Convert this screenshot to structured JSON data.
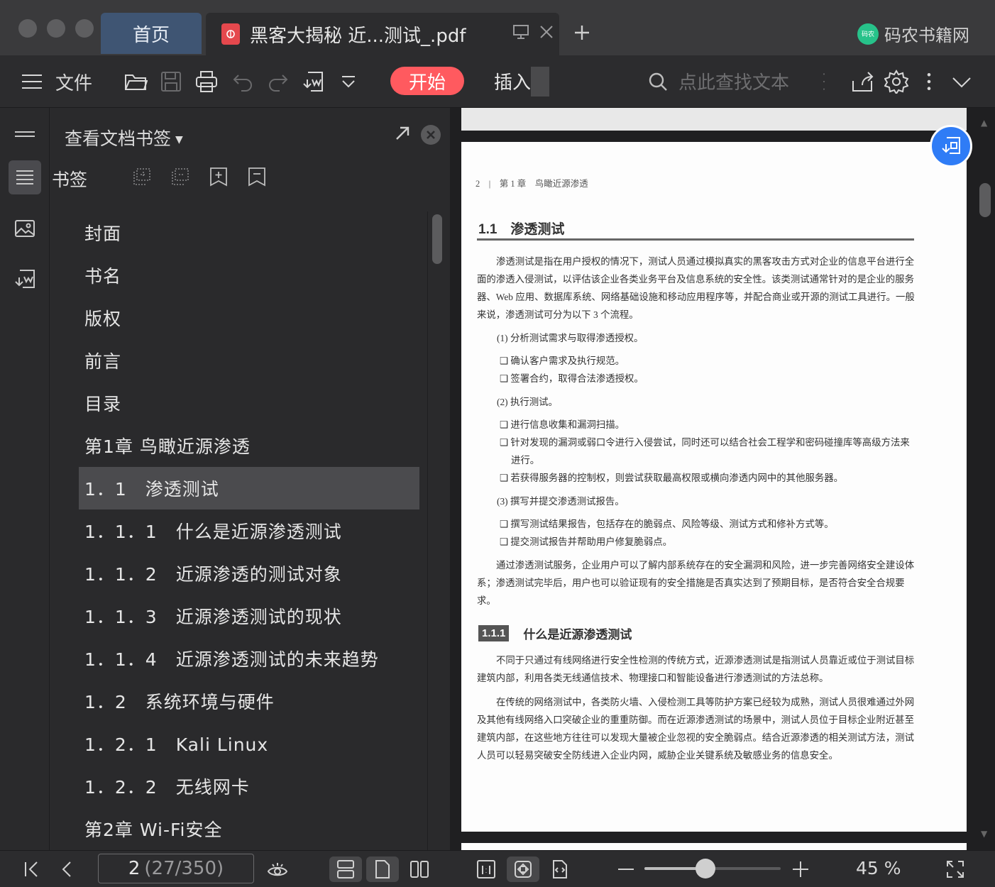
{
  "titlebar": {
    "home_tab": "首页",
    "doc_tab": "黑客大揭秘 近...测试_.pdf",
    "brand_logo_text": "码农",
    "brand": "码农书籍网"
  },
  "toolbar": {
    "file_label": "文件",
    "start_label": "开始",
    "insert_label": "插入",
    "search_placeholder": "点此查找文本"
  },
  "panel": {
    "title": "查看文档书签",
    "bookmark_label": "书签",
    "items": [
      {
        "label": "封面"
      },
      {
        "label": "书名"
      },
      {
        "label": "版权"
      },
      {
        "label": "前言"
      },
      {
        "label": "目录"
      },
      {
        "label": "第1章 鸟瞰近源渗透"
      },
      {
        "label": "1．1　渗透测试"
      },
      {
        "label": "1．1．1　什么是近源渗透测试"
      },
      {
        "label": "1．1．2　近源渗透的测试对象"
      },
      {
        "label": "1．1．3　近源渗透测试的现状"
      },
      {
        "label": "1．1．4　近源渗透测试的未来趋势"
      },
      {
        "label": "1．2　系统环境与硬件"
      },
      {
        "label": "1．2．1　Kali Linux"
      },
      {
        "label": "1．2．2　无线网卡"
      },
      {
        "label": "第2章 Wi-Fi安全"
      }
    ],
    "selected_index": 6
  },
  "page": {
    "header": "2　|　第 1 章　鸟瞰近源渗透",
    "h1": "1.1　渗透测试",
    "para1": "渗透测试是指在用户授权的情况下，测试人员通过模拟真实的黑客攻击方式对企业的信息平台进行全面的渗透入侵测试，以评估该企业各类业务平台及信息系统的安全性。该类测试通常针对的是企业的服务器、Web 应用、数据库系统、网络基础设施和移动应用程序等，并配合商业或开源的测试工具进行。一般来说，渗透测试可分为以下 3 个流程。",
    "step1": "(1) 分析测试需求与取得渗透授权。",
    "b1": "❑ 确认客户需求及执行规范。",
    "b2": "❑ 签署合约，取得合法渗透授权。",
    "step2": "(2) 执行测试。",
    "b3": "❑ 进行信息收集和漏洞扫描。",
    "b4": "❑ 针对发现的漏洞或弱口令进行入侵尝试，同时还可以结合社会工程学和密码碰撞库等高级方法来进行。",
    "b5": "❑ 若获得服务器的控制权，则尝试获取最高权限或横向渗透内网中的其他服务器。",
    "step3": "(3) 撰写并提交渗透测试报告。",
    "b6": "❑ 撰写测试结果报告，包括存在的脆弱点、风险等级、测试方式和修补方式等。",
    "b7": "❑ 提交测试报告并帮助用户修复脆弱点。",
    "para2": "通过渗透测试服务，企业用户可以了解内部系统存在的安全漏洞和风险，进一步完善网络安全建设体系；渗透测试完毕后，用户也可以验证现有的安全措施是否真实达到了预期目标，是否符合安全合规要求。",
    "h2_num": "1.1.1",
    "h2": "什么是近源渗透测试",
    "para3": "不同于只通过有线网络进行安全性检测的传统方式，近源渗透测试是指测试人员靠近或位于测试目标建筑内部，利用各类无线通信技术、物理接口和智能设备进行渗透测试的方法总称。",
    "para4": "在传统的网络测试中，各类防火墙、入侵检测工具等防护方案已经较为成熟，测试人员很难通过外网及其他有线网络入口突破企业的重重防御。而在近源渗透测试的场景中，测试人员位于目标企业附近甚至建筑内部，在这些地方往往可以发现大量被企业忽视的安全脆弱点。结合近源渗透的相关测试方法，测试人员可以轻易突破安全防线进入企业内网，威胁企业关键系统及敏感业务的信息安全。"
  },
  "statusbar": {
    "page_current": "2",
    "page_total": "(27/350)",
    "zoom": "45 %",
    "zoom_level": 0.45
  }
}
